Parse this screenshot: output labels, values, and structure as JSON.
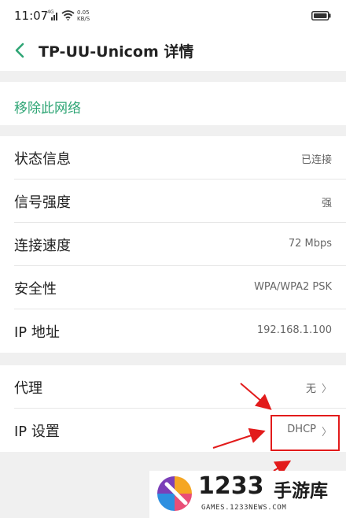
{
  "status_bar": {
    "time": "11:07",
    "network_type": "4G",
    "speed_value": "0.05",
    "speed_unit": "KB/S"
  },
  "header": {
    "title": "TP-UU-Unicom 详情",
    "back_icon": "chevron-left-icon"
  },
  "forget_section": {
    "label": "移除此网络"
  },
  "info_section": {
    "rows": [
      {
        "label": "状态信息",
        "value": "已连接"
      },
      {
        "label": "信号强度",
        "value": "强"
      },
      {
        "label": "连接速度",
        "value": "72 Mbps"
      },
      {
        "label": "安全性",
        "value": "WPA/WPA2 PSK"
      },
      {
        "label": "IP 地址",
        "value": "192.168.1.100"
      }
    ]
  },
  "settings_section": {
    "rows": [
      {
        "label": "代理",
        "value": "无"
      },
      {
        "label": "IP 设置",
        "value": "DHCP"
      }
    ]
  },
  "watermark": {
    "number": "1233",
    "brand": "手游库",
    "url": "GAMES.1233NEWS.COM"
  },
  "colors": {
    "accent": "#2fa575",
    "annotation": "#e21b1b",
    "background": "#f0f0f0"
  }
}
